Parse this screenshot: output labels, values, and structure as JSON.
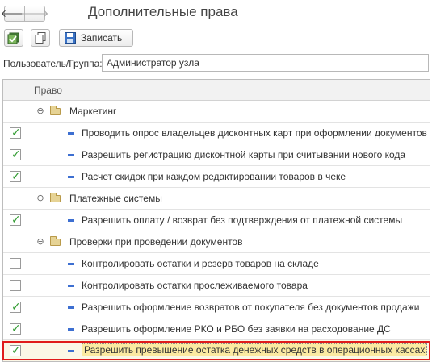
{
  "window": {
    "title": "Дополнительные права"
  },
  "nav": {
    "back_glyph": "🡐",
    "forward_glyph": "🡒"
  },
  "toolbar": {
    "save_label": "Записать"
  },
  "user": {
    "label": "Пользователь/Группа:",
    "value": "Администратор узла"
  },
  "table": {
    "header": "Право",
    "rows": [
      {
        "type": "group",
        "label": "Маркетинг"
      },
      {
        "type": "item",
        "checked": true,
        "label": "Проводить опрос владельцев дисконтных карт при оформлении документов"
      },
      {
        "type": "item",
        "checked": true,
        "label": "Разрешить регистрацию дисконтной карты при считывании нового кода"
      },
      {
        "type": "item",
        "checked": true,
        "label": "Расчет скидок при каждом редактировании товаров в чеке"
      },
      {
        "type": "group",
        "label": "Платежные системы"
      },
      {
        "type": "item",
        "checked": true,
        "label": "Разрешить оплату / возврат без подтверждения от платежной системы"
      },
      {
        "type": "group",
        "label": "Проверки при проведении документов"
      },
      {
        "type": "item",
        "checked": false,
        "label": "Контролировать остатки и резерв товаров на складе"
      },
      {
        "type": "item",
        "checked": false,
        "label": "Контролировать остатки прослеживаемого товара"
      },
      {
        "type": "item",
        "checked": true,
        "label": "Разрешить оформление возвратов от покупателя без документов продажи"
      },
      {
        "type": "item",
        "checked": true,
        "label": "Разрешить оформление РКО и РБО без заявки на расходование ДС"
      },
      {
        "type": "item",
        "checked": true,
        "selected": true,
        "label": "Разрешить превышение остатка денежных средств в операционных кассах"
      }
    ]
  },
  "colors": {
    "check": "#2e9a2e",
    "highlight_frame": "#e01b1b",
    "selected_cell": "#fbeaa1",
    "item_marker": "#3d6fd1",
    "folder": "#e6d395"
  },
  "icons": {
    "collapse": "⊖",
    "check": "✓"
  }
}
